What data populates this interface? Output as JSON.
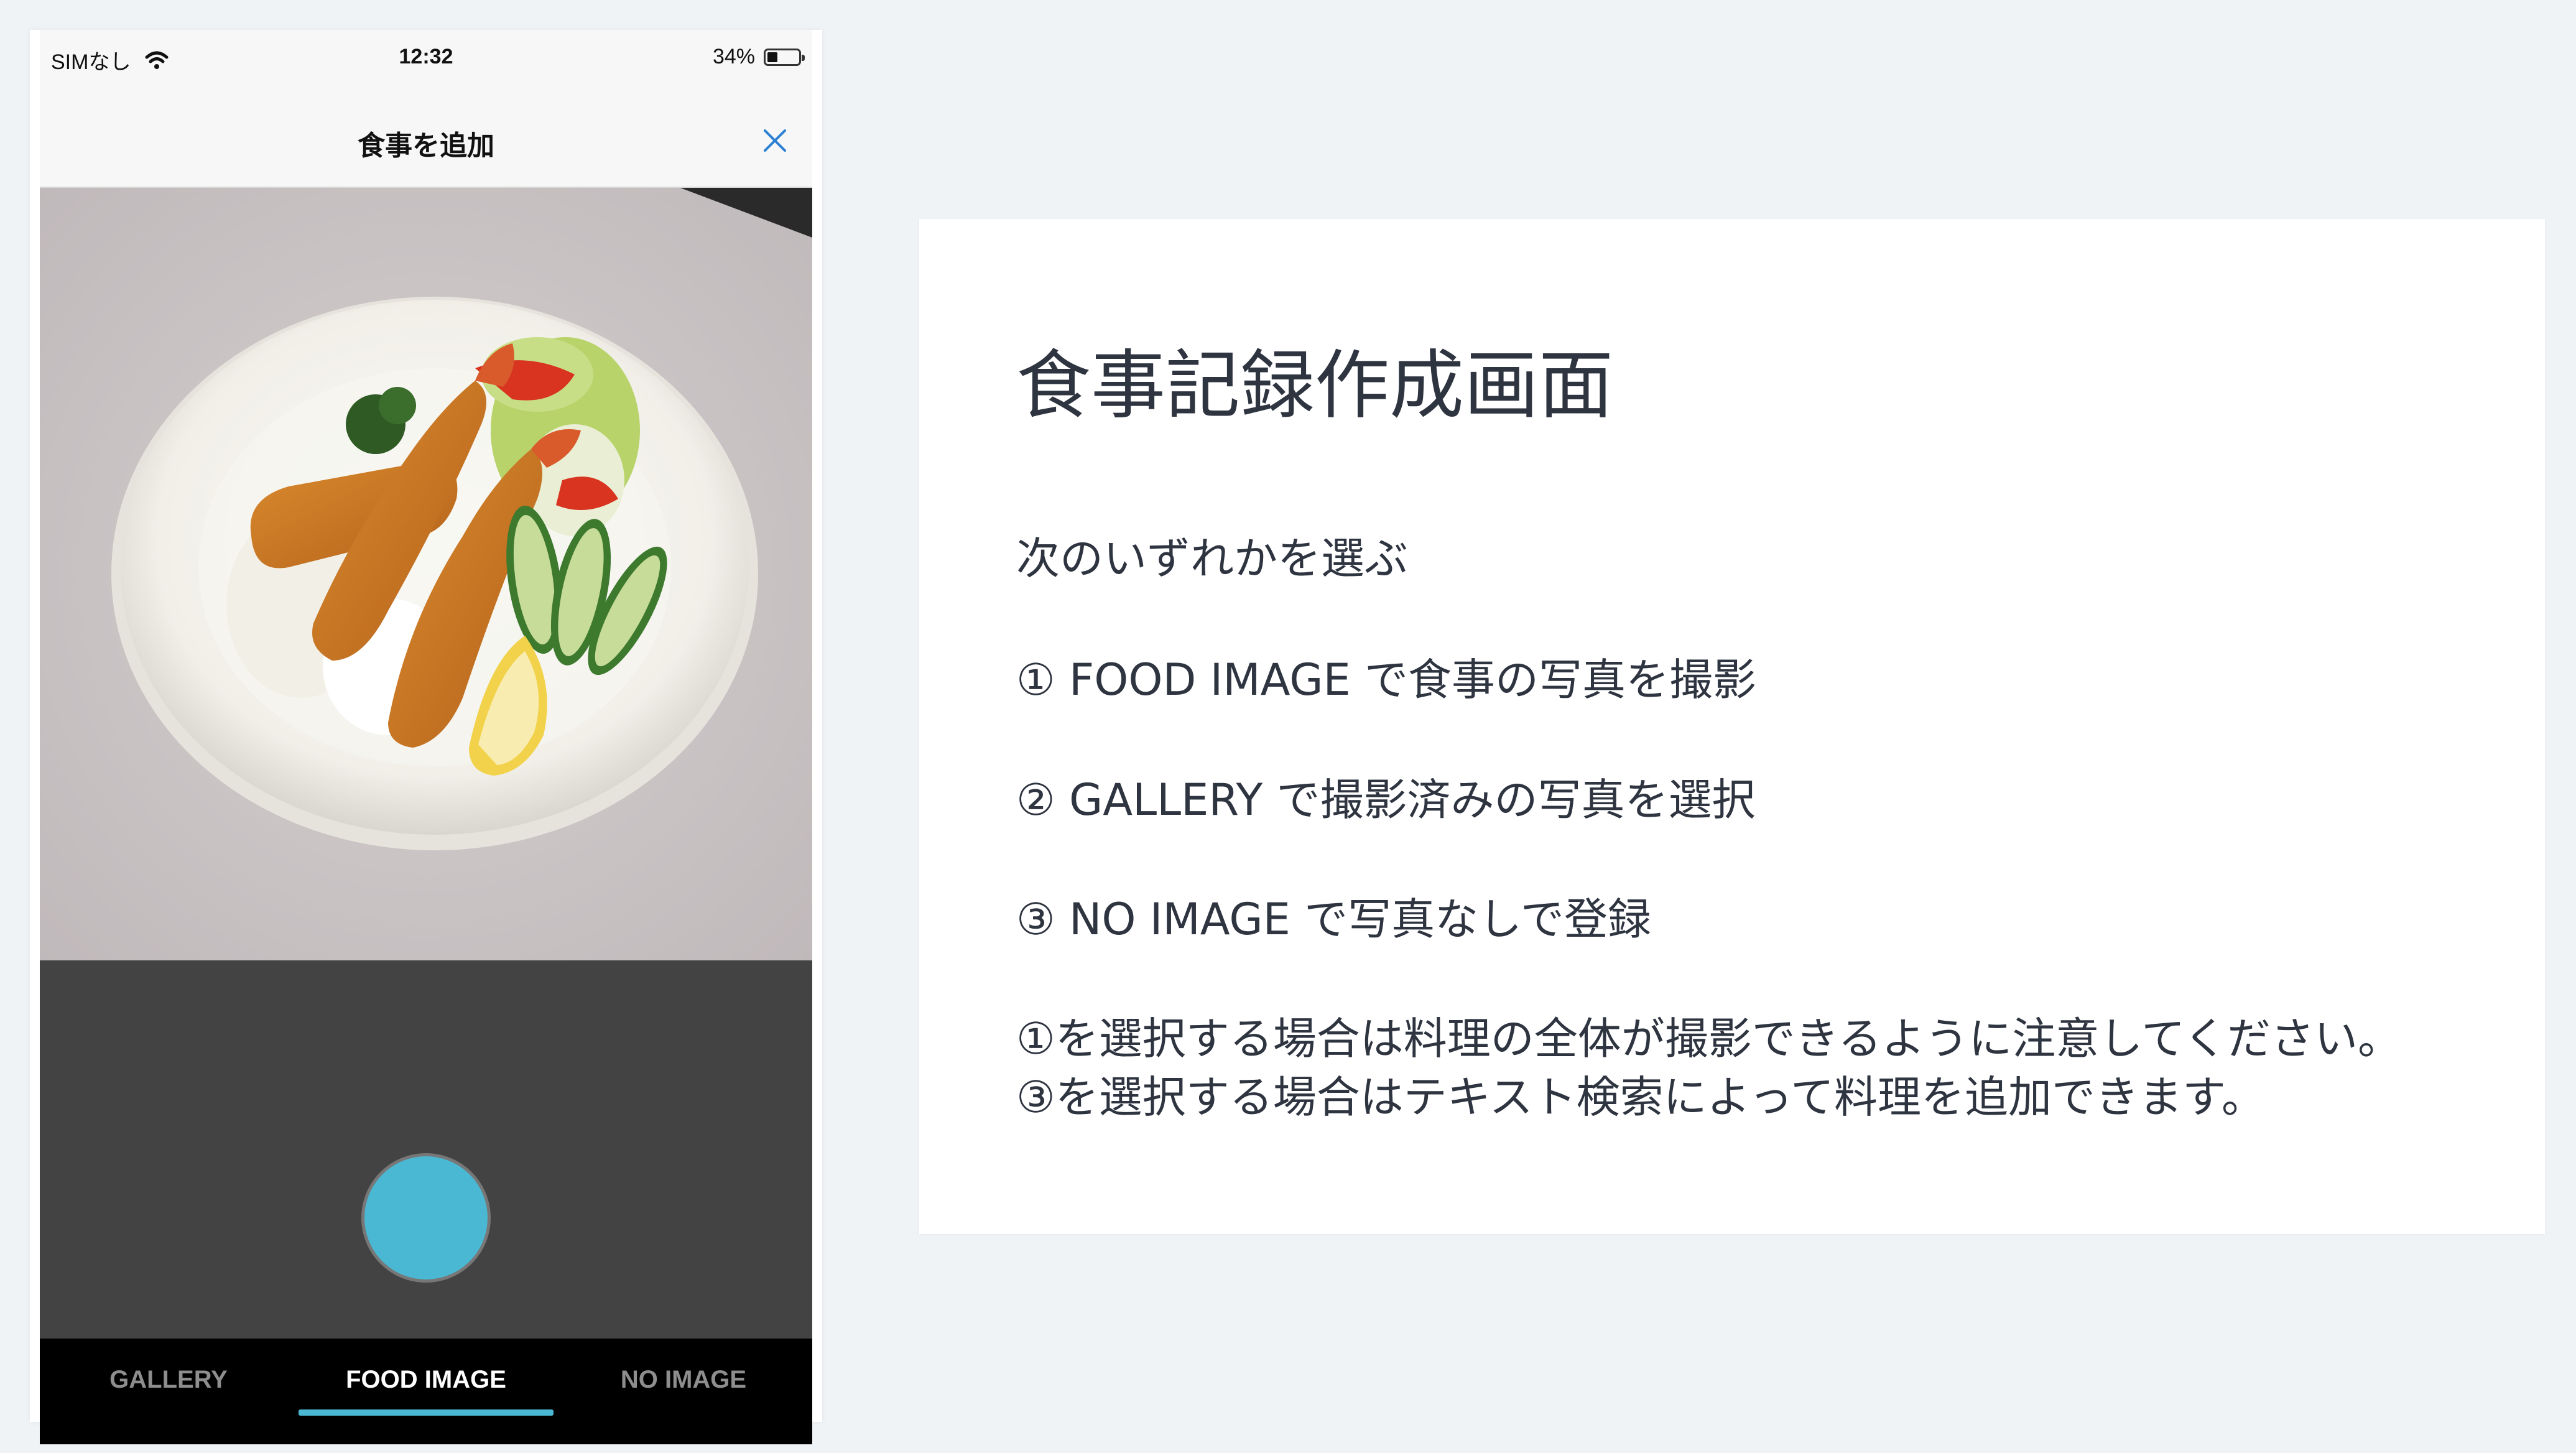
{
  "status_bar": {
    "carrier": "SIMなし",
    "time": "12:32",
    "battery": "34%",
    "battery_level": 0.34
  },
  "nav": {
    "title": "食事を追加"
  },
  "camera": {
    "shutter_color": "#4ab8d3"
  },
  "tabs": [
    {
      "label": "GALLERY",
      "active": false
    },
    {
      "label": "FOOD IMAGE",
      "active": true
    },
    {
      "label": "NO IMAGE",
      "active": false
    }
  ],
  "card": {
    "title": "食事記録作成画面",
    "instruction": "次のいずれかを選ぶ",
    "option1": "① FOOD IMAGE で食事の写真を撮影",
    "option2": "② GALLERY で撮影済みの写真を選択",
    "option3": "③ NO IMAGE で写真なしで登録",
    "note1": "①を選択する場合は料理の全体が撮影できるように注意してください。",
    "note2": "③を選択する場合はテキスト検索によって料理を追加できます。"
  },
  "colors": {
    "accent": "#4ab8d3",
    "close_icon": "#2a7fd4",
    "camera_bg": "#434343",
    "tab_bar_bg": "#000000"
  }
}
